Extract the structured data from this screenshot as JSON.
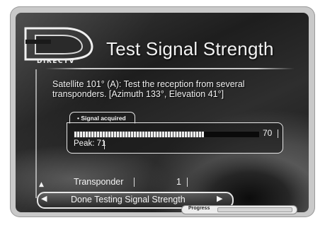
{
  "brand": {
    "logo_text": "DIRECTV"
  },
  "header": {
    "title": "Test Signal Strength"
  },
  "description": "Satellite 101° (A): Test the reception from several transponders. [Azimuth 133°, Elevation 41°]",
  "signal": {
    "status_tab": "• Signal acquired",
    "meter_value": "70",
    "meter_fraction": 0.7,
    "peak_text": "Peak: 71"
  },
  "transponder": {
    "label": "Transponder",
    "value": "1"
  },
  "actions": {
    "done_label": "Done Testing Signal Strength"
  },
  "footer": {
    "progress_label": "Progress",
    "progress_fraction": 0.0
  },
  "icons": {
    "up": "up-arrow-icon",
    "left": "left-arrow-icon",
    "right": "right-arrow-icon"
  }
}
